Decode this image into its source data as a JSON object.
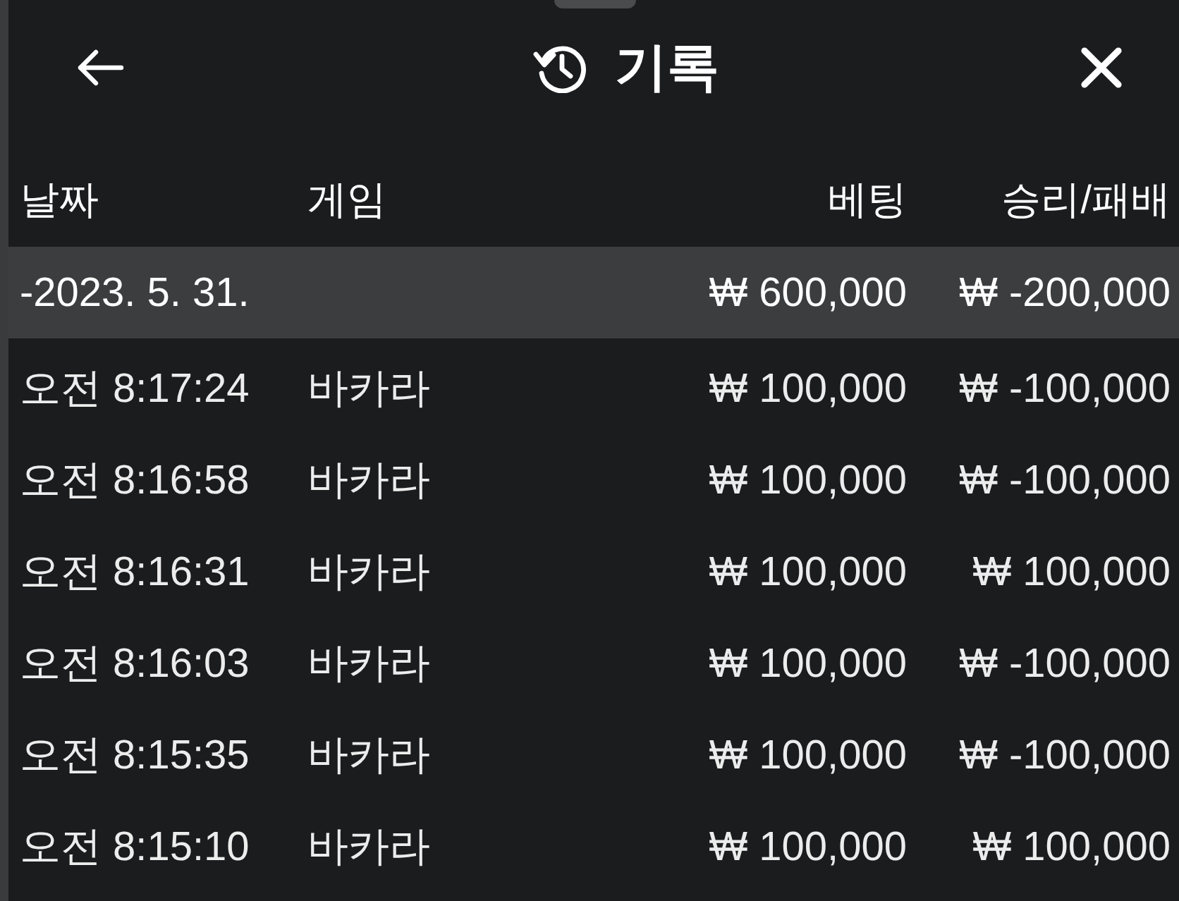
{
  "header": {
    "title": "기록"
  },
  "columns": [
    "날짜",
    "게임",
    "베팅",
    "승리/패배"
  ],
  "summary": {
    "date": "-2023. 5. 31.",
    "bet": "₩ 600,000",
    "result": "₩ -200,000"
  },
  "rows": [
    {
      "time": "오전 8:17:24",
      "game": "바카라",
      "bet": "₩ 100,000",
      "result": "₩ -100,000"
    },
    {
      "time": "오전 8:16:58",
      "game": "바카라",
      "bet": "₩ 100,000",
      "result": "₩ -100,000"
    },
    {
      "time": "오전 8:16:31",
      "game": "바카라",
      "bet": "₩ 100,000",
      "result": "₩ 100,000"
    },
    {
      "time": "오전 8:16:03",
      "game": "바카라",
      "bet": "₩ 100,000",
      "result": "₩ -100,000"
    },
    {
      "time": "오전 8:15:35",
      "game": "바카라",
      "bet": "₩ 100,000",
      "result": "₩ -100,000"
    },
    {
      "time": "오전 8:15:10",
      "game": "바카라",
      "bet": "₩ 100,000",
      "result": "₩ 100,000"
    }
  ]
}
